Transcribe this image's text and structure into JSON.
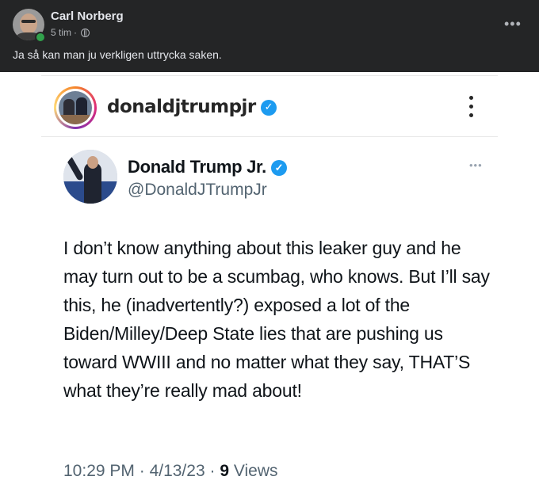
{
  "facebook_post": {
    "author": "Carl Norberg",
    "time": "5 tim",
    "separator": "·",
    "caption": "Ja så kan man ju verkligen uttrycka saken."
  },
  "instagram_post": {
    "username": "donaldjtrumpjr"
  },
  "tweet": {
    "display_name": "Donald Trump Jr.",
    "handle": "@DonaldJTrumpJr",
    "text": "I don’t know anything about this leaker guy and he may turn out to be a scumbag, who knows. But I’ll say this, he (inadvertently?) exposed a lot of the Biden/Milley/Deep State lies that are pushing us toward WWIII and no matter what they say, THAT’S what they’re really mad about!",
    "time": "10:29 PM",
    "date": "4/13/23",
    "views_count": "9",
    "views_label": "Views"
  },
  "icons": {
    "verified": "✓",
    "more": "•••",
    "tweet_more": "•••",
    "globe": "globe-icon"
  },
  "colors": {
    "fb_header_bg": "#242526",
    "verified_blue": "#1d9bf0",
    "online_green": "#31a24c"
  }
}
